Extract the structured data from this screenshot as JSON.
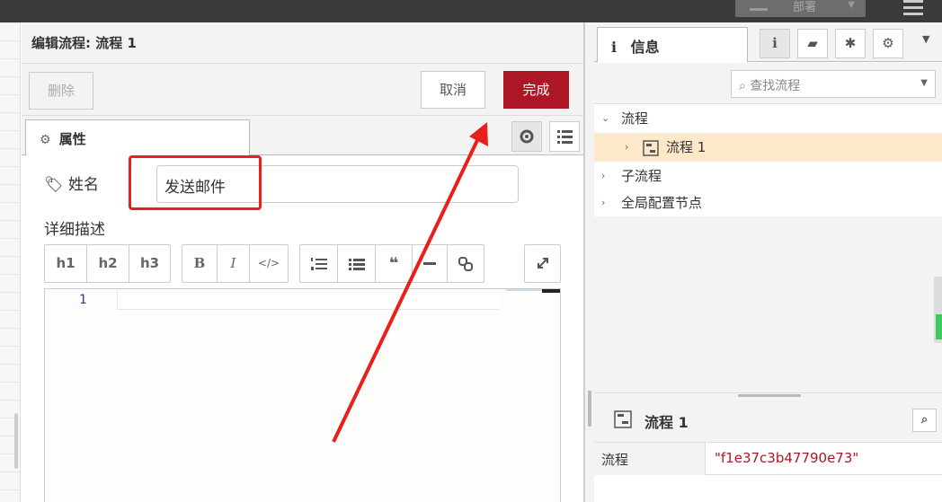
{
  "topbar": {
    "deploy_label": "部署"
  },
  "tray": {
    "title": "编辑流程: 流程 1",
    "delete_label": "删除",
    "cancel_label": "取消",
    "done_label": "完成",
    "tab_props_label": "属性",
    "name_label": "姓名",
    "name_value": "发送邮件",
    "desc_label": "详细描述",
    "md_buttons": {
      "h1": "h1",
      "h2": "h2",
      "h3": "h3",
      "bold": "B",
      "italic": "I",
      "code": "</>"
    },
    "editor": {
      "line_number": "1"
    }
  },
  "sidebar": {
    "tab_info_label": "信息",
    "search_placeholder": "查找流程",
    "tree": {
      "flows": "流程",
      "flow1": "流程 1",
      "subflows": "子流程",
      "global_config": "全局配置节点"
    },
    "info": {
      "title": "流程 1",
      "prop_key": "流程",
      "prop_value": "\"f1e37c3b47790e73\""
    }
  },
  "colors": {
    "accent": "#ad1625",
    "annotation": "#e8201b",
    "selected": "#fde8c9"
  }
}
